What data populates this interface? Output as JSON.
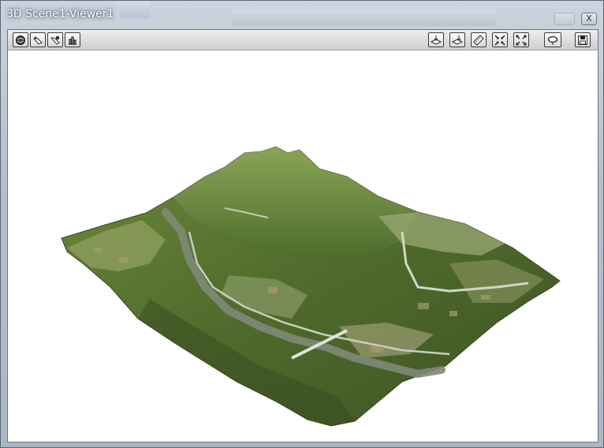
{
  "window": {
    "title": "3D Scene1-Viewer1",
    "close_label": "X"
  },
  "toolbar": {
    "left_tools": [
      {
        "icon": "globe-icon"
      },
      {
        "icon": "pan-icon"
      },
      {
        "icon": "zoom-icon"
      },
      {
        "icon": "fly-icon"
      }
    ],
    "right_tools": [
      {
        "icon": "layer-up-icon"
      },
      {
        "icon": "layer-down-icon"
      },
      {
        "icon": "measure-icon"
      },
      {
        "icon": "zoom-in-extent-icon"
      },
      {
        "icon": "zoom-out-extent-icon"
      },
      {
        "icon": "rotate-icon"
      },
      {
        "icon": "save-icon"
      }
    ]
  },
  "scene": {
    "type": "3D terrain with aerial imagery",
    "colors": {
      "terrain_dark": "#4a5a2c",
      "terrain_green": "#6b8a3a",
      "terrain_light": "#9aae6a",
      "river": "#7f8a78",
      "road": "#c9cdbf",
      "background": "#ffffff"
    }
  }
}
